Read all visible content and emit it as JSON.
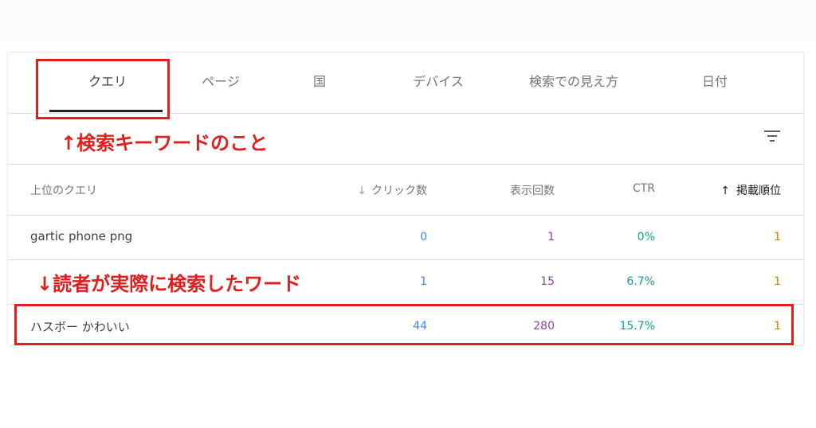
{
  "tabs": [
    {
      "label": "クエリ",
      "active": true
    },
    {
      "label": "ページ",
      "active": false
    },
    {
      "label": "国",
      "active": false
    },
    {
      "label": "デバイス",
      "active": false
    },
    {
      "label": "検索での見え方",
      "active": false
    },
    {
      "label": "日付",
      "active": false
    }
  ],
  "toolbar": {
    "filter_icon": "filter-list-icon"
  },
  "table": {
    "headers": {
      "query": "上位のクエリ",
      "clicks": "クリック数",
      "clicks_sort_icon": "arrow-down-icon",
      "impressions": "表示回数",
      "ctr": "CTR",
      "position": "掲載順位",
      "position_sort_icon": "arrow-up-icon"
    },
    "rows": [
      {
        "query": "gartic phone png",
        "clicks": "0",
        "impressions": "1",
        "ctr": "0%",
        "position": "1"
      },
      {
        "query": "",
        "clicks": "1",
        "impressions": "15",
        "ctr": "6.7%",
        "position": "1"
      },
      {
        "query": "ハスボー かわいい",
        "clicks": "44",
        "impressions": "280",
        "ctr": "15.7%",
        "position": "1"
      }
    ]
  },
  "annotations": {
    "keyword_note": "↑検索キーワードのこと",
    "query_note": "↓読者が実際に検索したワード"
  },
  "colors": {
    "clicks": "#4285f4",
    "impressions": "#8e44ad",
    "ctr": "#12a090",
    "position": "#e37400",
    "annotation": "#e01e1e"
  }
}
